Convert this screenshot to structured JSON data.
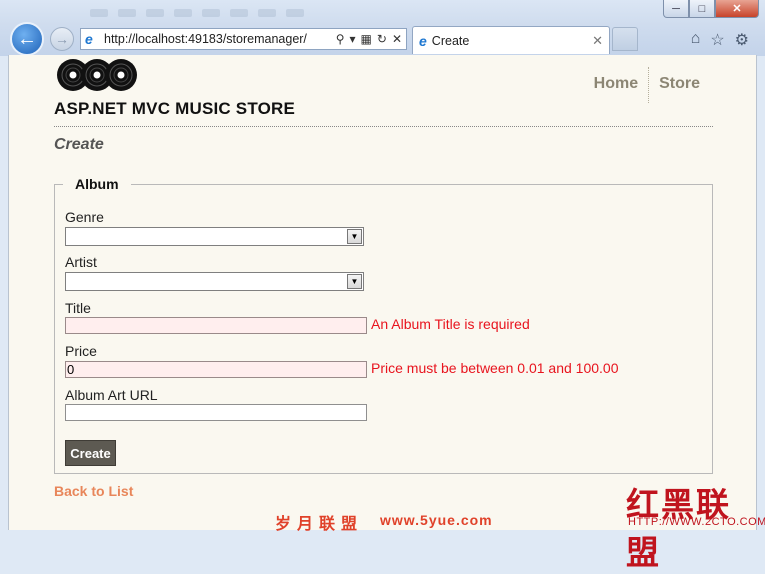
{
  "browser": {
    "address_url": "http://localhost:49183/storemanager/",
    "tab_title": "Create",
    "window_buttons": [
      "minimize-icon",
      "maximize-icon",
      "close-icon"
    ],
    "nav_icons": [
      "back-icon",
      "forward-icon"
    ],
    "right_icons": [
      "home-icon",
      "favorites-star-icon",
      "settings-gear-icon"
    ]
  },
  "site": {
    "title": "ASP.NET MVC MUSIC STORE",
    "logo_icon": "vinyl-records-logo",
    "menu": [
      {
        "label": "Home"
      },
      {
        "label": "Store"
      }
    ]
  },
  "page": {
    "heading": "Create",
    "fieldset_legend": "Album",
    "fields": {
      "genre": {
        "label": "Genre",
        "value": ""
      },
      "artist": {
        "label": "Artist",
        "value": ""
      },
      "title": {
        "label": "Title",
        "value": "",
        "error": "An Album Title is required"
      },
      "price": {
        "label": "Price",
        "value": "0",
        "error": "Price must be between 0.01 and 100.00"
      },
      "album_art_url": {
        "label": "Album Art URL",
        "value": ""
      }
    },
    "submit_label": "Create",
    "back_link": "Back to List"
  },
  "watermarks": {
    "left_cn": "岁月联盟",
    "left_url": "www.5yue.com",
    "right_cn": "红黑联盟",
    "right_url": "HTTP://WWW.2CTO.COM"
  },
  "colors": {
    "page_bg": "#faf8f0",
    "error": "#e8141e",
    "invalid_input_bg": "#ffeeee",
    "link": "#e8865a",
    "button_bg": "#5d5a52",
    "menu_text": "#8c8674"
  }
}
